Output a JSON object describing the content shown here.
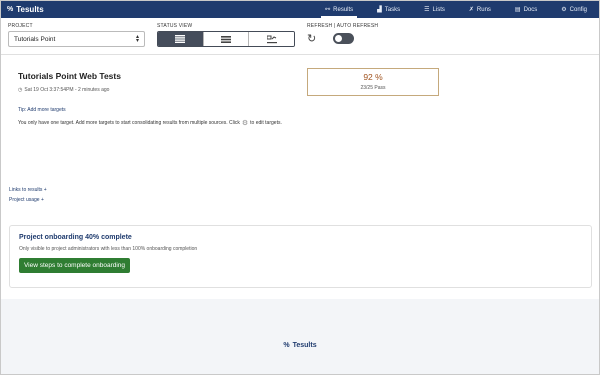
{
  "topbar": {
    "brand": "Tesults",
    "nav": [
      {
        "label": "Results",
        "icon": "results-icon",
        "glyph": "⚯"
      },
      {
        "label": "Tasks",
        "icon": "tasks-icon",
        "glyph": "▟"
      },
      {
        "label": "Lists",
        "icon": "lists-icon",
        "glyph": "☰"
      },
      {
        "label": "Runs",
        "icon": "runs-icon",
        "glyph": "✗"
      },
      {
        "label": "Docs",
        "icon": "docs-icon",
        "glyph": "▤"
      },
      {
        "label": "Config",
        "icon": "config-icon",
        "glyph": "⚙"
      }
    ],
    "active": "Results"
  },
  "controls": {
    "project_label": "PROJECT",
    "project_value": "Tutorials Point",
    "status_view_label": "STATUS VIEW",
    "refresh_label": "REFRESH | AUTO REFRESH"
  },
  "main": {
    "title": "Tutorials Point Web Tests",
    "timestamp": "Sat 19 Oct 3:37:54PM - 2 minutes ago",
    "score_pct": "92 %",
    "score_pass": "23/25 Pass",
    "tip": "Tip: Add more targets",
    "tip_text_before": "You only have one target. Add more targets to start consolidating results from multiple sources. Click",
    "tip_text_after": "to edit targets.",
    "links_results": "Links to results +",
    "project_usage": "Project usage +"
  },
  "onboarding": {
    "title": "Project onboarding 40% complete",
    "subtitle": "Only visible to project administrators with less than 100% onboarding completion",
    "button": "View steps to complete onboarding"
  },
  "footer": {
    "brand": "Tesults"
  },
  "colors": {
    "nav": "#1f3b6e",
    "score": "#a0521e",
    "button": "#2f7d32"
  }
}
